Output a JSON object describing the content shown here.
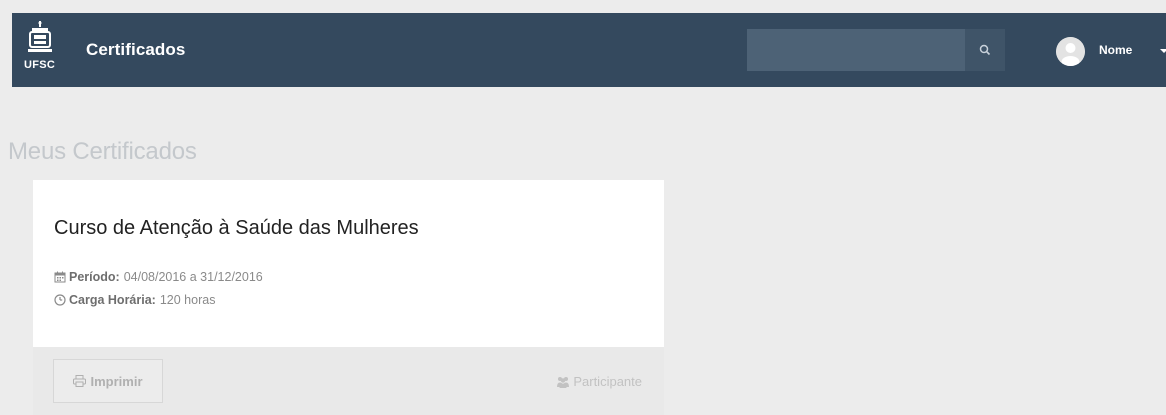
{
  "navbar": {
    "logo_text": "UFSC",
    "brand_title": "Certificados",
    "search": {
      "placeholder": "",
      "value": "",
      "icon": "search-icon"
    },
    "user": {
      "name": "Nome",
      "avatar_icon": "user-avatar-icon",
      "caret_icon": "caret-down-icon"
    }
  },
  "page": {
    "title": "Meus Certificados"
  },
  "certificates": [
    {
      "title": "Curso de Atenção à Saúde das Mulheres",
      "period_label": "Período:",
      "period_value": "04/08/2016 a 31/12/2016",
      "period_icon": "calendar-icon",
      "hours_label": "Carga Horária:",
      "hours_value": "120 horas",
      "hours_icon": "clock-icon",
      "print_label": "Imprimir",
      "print_icon": "printer-icon",
      "role_label": "Participante",
      "role_icon": "users-icon"
    }
  ],
  "colors": {
    "navbar": "#34495e",
    "background": "#ececec",
    "card": "#ffffff",
    "card_footer": "#e9e9e9"
  }
}
